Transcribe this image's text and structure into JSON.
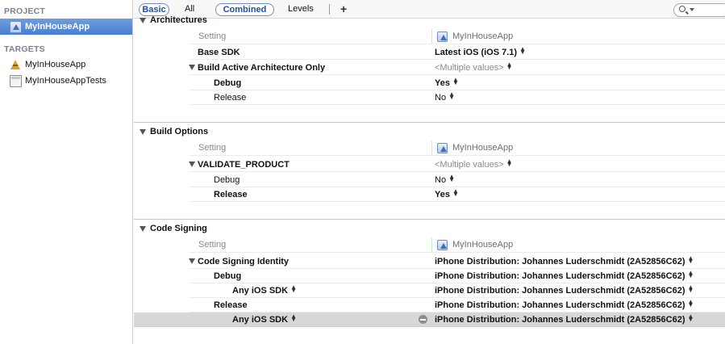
{
  "sidebar": {
    "project_header": "PROJECT",
    "project_item": "MyInHouseApp",
    "targets_header": "TARGETS",
    "targets": [
      "MyInHouseApp",
      "MyInHouseAppTests"
    ]
  },
  "toolbar": {
    "basic": "Basic",
    "all": "All",
    "combined": "Combined",
    "levels": "Levels",
    "add": "+"
  },
  "columns": {
    "setting": "Setting",
    "project": "MyInHouseApp"
  },
  "sections": {
    "architectures": {
      "title": "Architectures",
      "base_sdk": {
        "name": "Base SDK",
        "value": "Latest iOS (iOS 7.1)"
      },
      "build_active": {
        "name": "Build Active Architecture Only",
        "value": "<Multiple values>"
      },
      "debug": {
        "name": "Debug",
        "value": "Yes"
      },
      "release": {
        "name": "Release",
        "value": "No"
      }
    },
    "build_options": {
      "title": "Build Options",
      "validate": {
        "name": "VALIDATE_PRODUCT",
        "value": "<Multiple values>"
      },
      "debug": {
        "name": "Debug",
        "value": "No"
      },
      "release": {
        "name": "Release",
        "value": "Yes"
      }
    },
    "code_signing": {
      "title": "Code Signing",
      "identity": {
        "name": "Code Signing Identity",
        "value": "iPhone Distribution: Johannes Luderschmidt (2A52856C62)"
      },
      "debug": {
        "name": "Debug",
        "value": "iPhone Distribution: Johannes Luderschmidt (2A52856C62)"
      },
      "debug_any": {
        "name": "Any iOS SDK",
        "value": "iPhone Distribution: Johannes Luderschmidt (2A52856C62)"
      },
      "release": {
        "name": "Release",
        "value": "iPhone Distribution: Johannes Luderschmidt (2A52856C62)"
      },
      "release_any": {
        "name": "Any iOS SDK",
        "value": "iPhone Distribution: Johannes Luderschmidt (2A52856C62)"
      }
    }
  },
  "colors": {
    "selection": "#4a7fcf",
    "accent": "#6f92c9"
  }
}
